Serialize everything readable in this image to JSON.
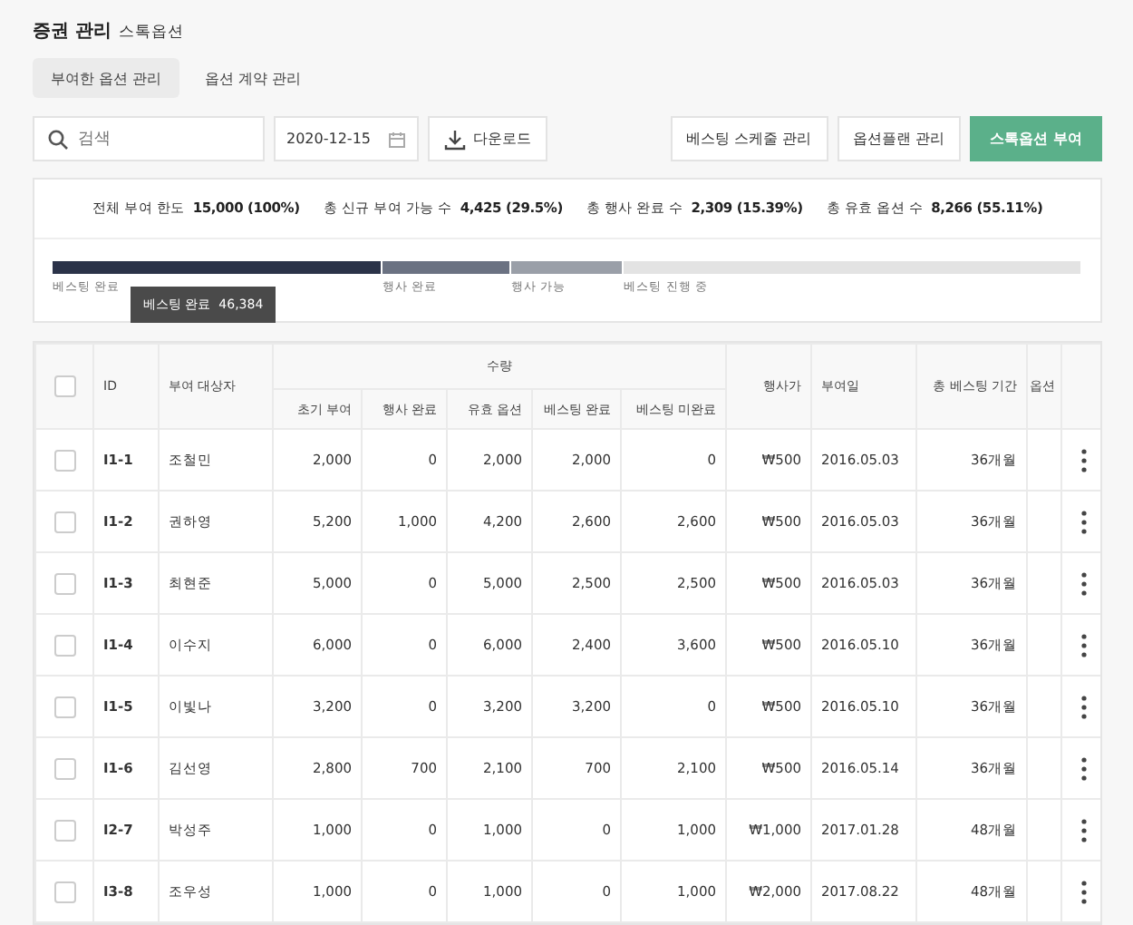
{
  "header": {
    "title": "증권 관리",
    "subtitle": "스톡옵션"
  },
  "tabs": [
    {
      "label": "부여한 옵션 관리",
      "selected": true
    },
    {
      "label": "옵션 계약 관리",
      "selected": false
    }
  ],
  "toolbar": {
    "search": {
      "placeholder": "검색"
    },
    "date": "2020-12-15",
    "download": "다운로드",
    "buttons": [
      {
        "label": "베스팅 스케줄 관리",
        "kind": "plain"
      },
      {
        "label": "옵션플랜 관리",
        "kind": "plain"
      },
      {
        "label": "스톡옵션 부여",
        "kind": "primary"
      }
    ]
  },
  "summary": [
    {
      "label": "전체 부여 한도",
      "value": "15,000 (100%)"
    },
    {
      "label": "총 신규 부여 가능 수",
      "value": "4,425 (29.5%)"
    },
    {
      "label": "총 행사 완료 수",
      "value": "2,309 (15.39%)"
    },
    {
      "label": "총 유효 옵션 수",
      "value": "8,266 (55.11%)"
    }
  ],
  "progress": {
    "segments": [
      {
        "label": "베스팅 완료",
        "color": "#2b3349"
      },
      {
        "label": "행사 완료",
        "color": "#6b7282"
      },
      {
        "label": "행사 가능",
        "color": "#9a9fa8"
      },
      {
        "label": "베스팅 진행 중",
        "color": "#e3e3e3"
      }
    ],
    "tooltip": {
      "label": "베스팅 완료",
      "value": "46,384"
    }
  },
  "table": {
    "header_checked": false,
    "group_header": "수량",
    "columns": [
      "ID",
      "부여 대상자",
      "초기 부여",
      "행사 완료",
      "유효 옵션",
      "베스팅 완료",
      "베스팅 미완료",
      "행사가",
      "부여일",
      "총 베스팅 기간",
      "옵션"
    ],
    "rows": [
      {
        "checked": false,
        "id": "I1-1",
        "name": "조철민",
        "values": [
          "2,000",
          "0",
          "2,000",
          "2,000",
          "0",
          "₩500",
          "2016.05.03",
          "36개월"
        ]
      },
      {
        "checked": false,
        "id": "I1-2",
        "name": "권하영",
        "values": [
          "5,200",
          "1,000",
          "4,200",
          "2,600",
          "2,600",
          "₩500",
          "2016.05.03",
          "36개월"
        ]
      },
      {
        "checked": false,
        "id": "I1-3",
        "name": "최현준",
        "values": [
          "5,000",
          "0",
          "5,000",
          "2,500",
          "2,500",
          "₩500",
          "2016.05.03",
          "36개월"
        ]
      },
      {
        "checked": false,
        "id": "I1-4",
        "name": "이수지",
        "values": [
          "6,000",
          "0",
          "6,000",
          "2,400",
          "3,600",
          "₩500",
          "2016.05.10",
          "36개월"
        ]
      },
      {
        "checked": false,
        "id": "I1-5",
        "name": "이빛나",
        "values": [
          "3,200",
          "0",
          "3,200",
          "3,200",
          "0",
          "₩500",
          "2016.05.10",
          "36개월"
        ]
      },
      {
        "checked": false,
        "id": "I1-6",
        "name": "김선영",
        "values": [
          "2,800",
          "700",
          "2,100",
          "700",
          "2,100",
          "₩500",
          "2016.05.14",
          "36개월"
        ]
      },
      {
        "checked": false,
        "id": "I2-7",
        "name": "박성주",
        "values": [
          "1,000",
          "0",
          "1,000",
          "0",
          "1,000",
          "₩1,000",
          "2017.01.28",
          "48개월"
        ]
      },
      {
        "checked": false,
        "id": "I3-8",
        "name": "조우성",
        "values": [
          "1,000",
          "0",
          "1,000",
          "0",
          "1,000",
          "₩2,000",
          "2017.08.22",
          "48개월"
        ]
      }
    ]
  }
}
